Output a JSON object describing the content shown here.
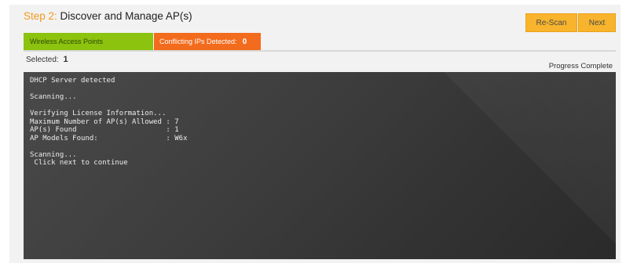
{
  "header": {
    "step_label": "Step 2:",
    "title": "Discover and Manage AP(s)"
  },
  "buttons": {
    "rescan": "Re-Scan",
    "next": "Next"
  },
  "tabs": {
    "wireless_label": "Wireless Access Points",
    "conflicting_label": "Conflicting IPs Detected:",
    "conflicting_count": "0"
  },
  "selection": {
    "label": "Selected:",
    "count": "1"
  },
  "status": {
    "progress_text": "Progress Complete"
  },
  "console": {
    "output": "DHCP Server detected\n\nScanning...\n\nVerifying License Information...\nMaximum Number of AP(s) Allowed : 7\nAP(s) Found                     : 1\nAP Models Found:                : W6x\n\nScanning...\n Click next to continue"
  },
  "colors": {
    "accent_orange": "#f39a1f",
    "button_yellow": "#f7b42c",
    "tab_green": "#8bc30f",
    "tab_orange": "#f36b1c",
    "console_bg": "#3a3a3a"
  }
}
